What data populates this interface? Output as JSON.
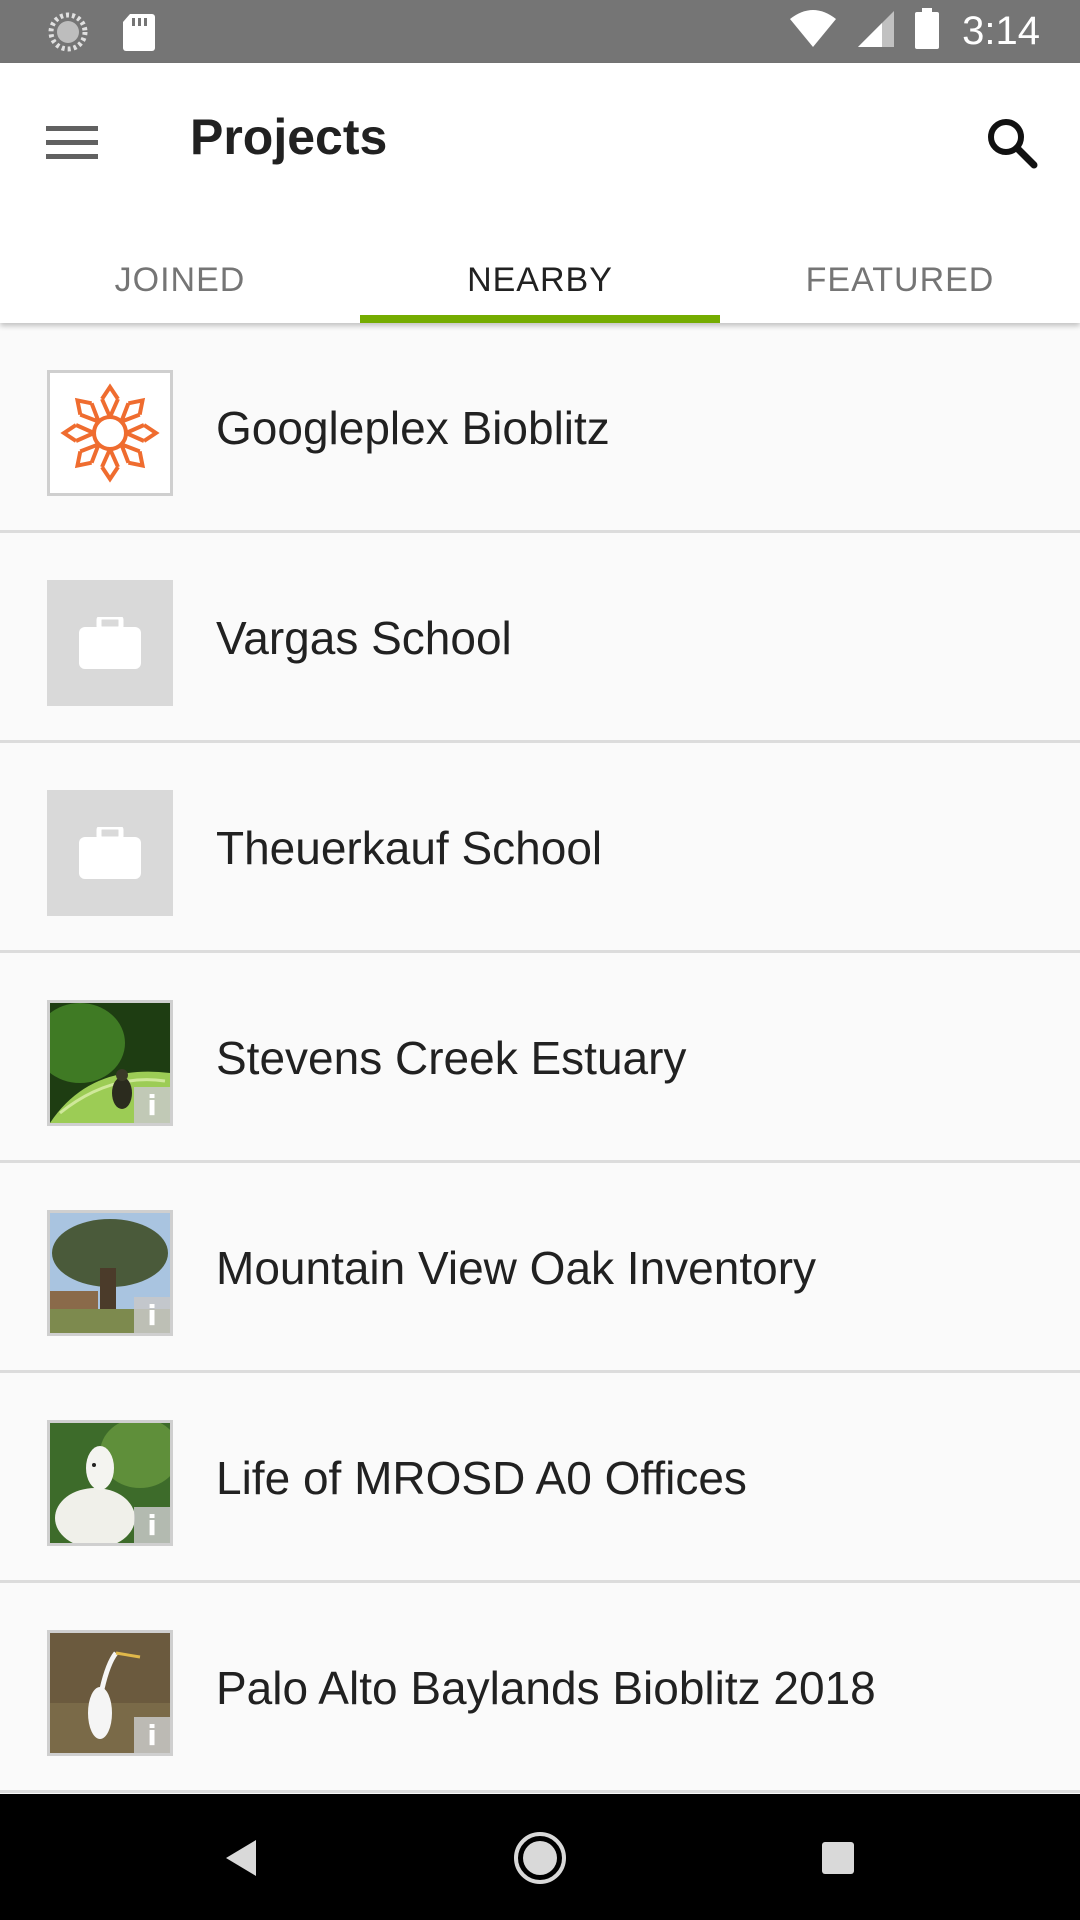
{
  "status_bar": {
    "time": "3:14",
    "left_icons": [
      "sync-icon",
      "sd-card-icon"
    ],
    "right_icons": [
      "wifi-icon",
      "cell-signal-icon",
      "battery-icon"
    ]
  },
  "app_bar": {
    "title": "Projects",
    "menu_icon": "hamburger-menu-icon",
    "search_icon": "search-icon"
  },
  "tabs": [
    {
      "label": "JOINED",
      "active": false
    },
    {
      "label": "NEARBY",
      "active": true
    },
    {
      "label": "FEATURED",
      "active": false
    }
  ],
  "colors": {
    "accent": "#74ac00",
    "status_bar": "#757575",
    "placeholder": "#d9d9d9",
    "logo_orange": "#ef6c2f"
  },
  "projects": [
    {
      "name": "Googleplex Bioblitz",
      "icon": "bioblitz-logo-icon"
    },
    {
      "name": "Vargas School",
      "icon": "briefcase-icon"
    },
    {
      "name": "Theuerkauf School",
      "icon": "briefcase-icon"
    },
    {
      "name": "Stevens Creek Estuary",
      "icon": "insect-on-leaf-photo"
    },
    {
      "name": "Mountain View Oak Inventory",
      "icon": "oak-tree-photo"
    },
    {
      "name": "Life of MROSD A0 Offices",
      "icon": "goat-photo"
    },
    {
      "name": "Palo Alto Baylands Bioblitz 2018",
      "icon": "egret-photo"
    }
  ],
  "nav_bar": {
    "back_icon": "back-triangle-icon",
    "home_icon": "home-circle-icon",
    "recents_icon": "recents-square-icon"
  }
}
